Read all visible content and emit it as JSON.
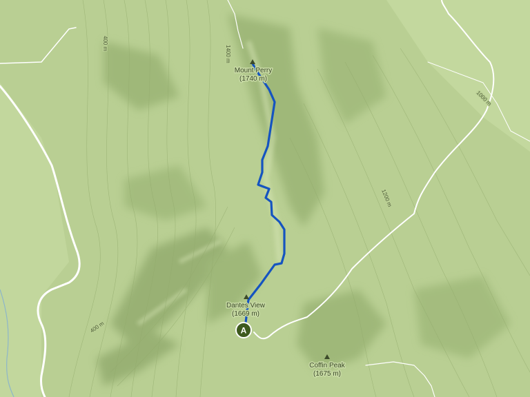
{
  "map": {
    "colors": {
      "terrain": "#b9cf93",
      "terrain_light": "#c6da9f",
      "shadow": "#7f9a5c",
      "route": "#1554c0",
      "road": "#ffffff",
      "marker": "#3e5a1e"
    },
    "peaks": [
      {
        "name": "Mount Perry",
        "elevation": "(1740 m)"
      },
      {
        "name": "Dantes View",
        "elevation": "(1669 m)"
      },
      {
        "name": "Coffin Peak",
        "elevation": "(1675 m)"
      }
    ],
    "contour_labels": [
      "400 m",
      "1400 m",
      "1000 m",
      "1200 m",
      "400 m"
    ],
    "marker": {
      "label": "A"
    }
  }
}
